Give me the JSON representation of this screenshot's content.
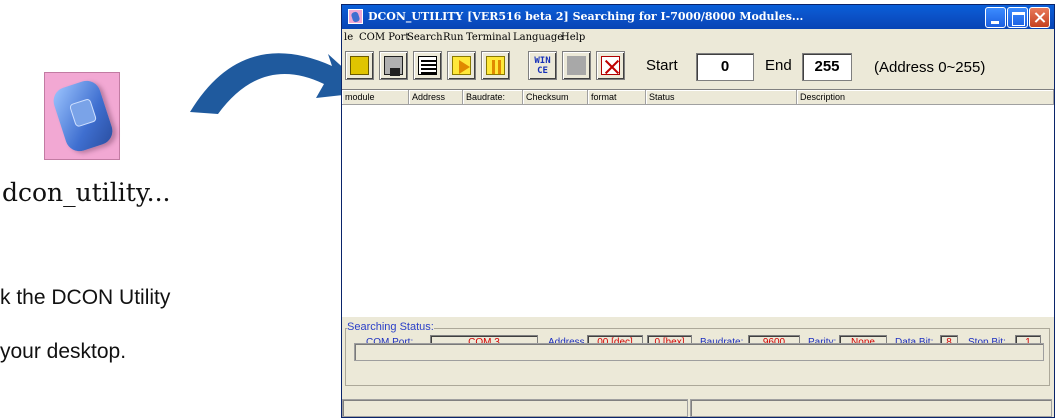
{
  "desktop": {
    "icon_caption": "dcon_utility...",
    "instruction_line1": "k the DCON Utility",
    "instruction_line2": "your desktop."
  },
  "window": {
    "title": "DCON_UTILITY [VER516 beta 2] Searching for I-7000/8000 Modules...",
    "menu": [
      "le",
      "COM Port",
      "Search",
      "Run",
      "Terminal",
      "Language",
      "Help"
    ],
    "toolbar": {
      "icons": [
        "open-folder-icon",
        "save-icon",
        "list-icon",
        "play-icon",
        "pause-icon",
        "wince-icon",
        "blank-icon",
        "exit-icon"
      ],
      "wince_text_1": "WIN",
      "wince_text_2": "CE",
      "start_label": "Start",
      "start_value": "0",
      "end_label": "End",
      "end_value": "255",
      "address_hint": "(Address 0~255)"
    },
    "list_columns": [
      "module",
      "Address",
      "Baudrate:",
      "Checksum",
      "format",
      "Status",
      "Description"
    ],
    "searching_status": {
      "title": "Searching Status:",
      "com_port_label": "COM Port:",
      "com_port_value": "COM 3",
      "address_label": "Address",
      "address_dec": "00 [dec]",
      "address_hex": "0 [hex]",
      "baudrate_label": "Baudrate:",
      "baudrate_value": "9600",
      "parity_label": "Parity:",
      "parity_value": "None",
      "data_bit_label": "Data Bit:",
      "data_bit_value": "8",
      "stop_bit_label": "Stop Bit:",
      "stop_bit_value": "1"
    },
    "colors": {
      "titlebar": "#0b52c8",
      "status_label": "#1c2fbf",
      "status_value": "#d40000",
      "arrow": "#1f5a9e"
    }
  }
}
